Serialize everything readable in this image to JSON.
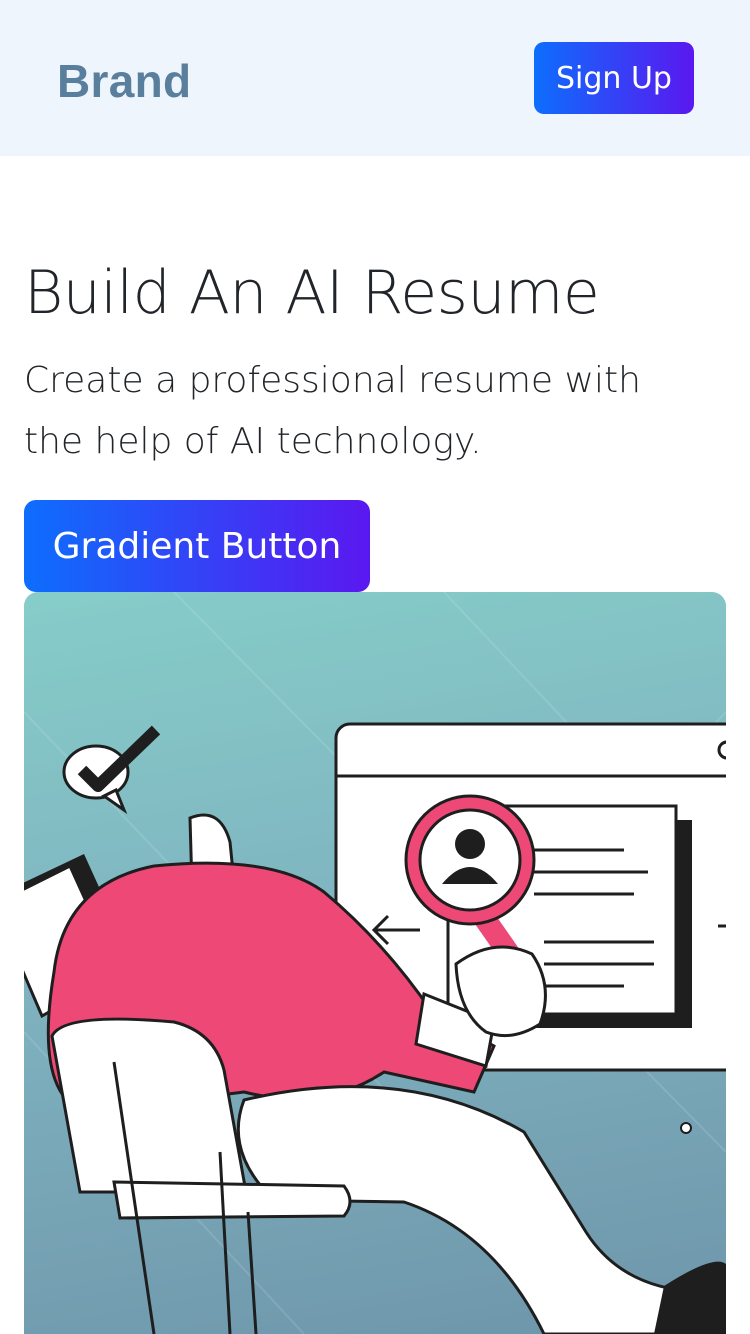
{
  "navbar": {
    "brand": "Brand",
    "signup_label": "Sign Up"
  },
  "hero": {
    "title": "Build An AI Resume",
    "subtitle": "Create a professional resume with the help of AI technology.",
    "cta_label": "Gradient Button"
  },
  "illustration": {
    "subject": "person-searching-resume",
    "accent_color": "#ee4876",
    "bg_top": "#86cdc9",
    "bg_bottom": "#6e95aa"
  },
  "colors": {
    "brand": "#5a7f9c",
    "gradient_start": "#0d6efd",
    "gradient_end": "#5a18f0",
    "navbar_bg": "#eef5fd"
  }
}
